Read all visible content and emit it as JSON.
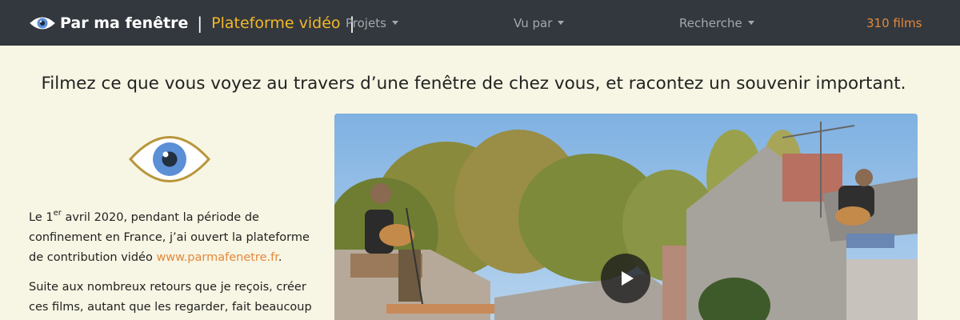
{
  "navbar": {
    "brand_title": "Par ma fenêtre",
    "brand_separator": "|",
    "brand_subtitle": "Plateforme vidéo",
    "items": [
      {
        "label": "Projets"
      },
      {
        "label": "Vu par"
      },
      {
        "label": "Recherche"
      }
    ],
    "films_count": "310 films",
    "brand_icon": "eye-icon"
  },
  "headline": "Filmez ce que vous voyez au travers d’une fenêtre de chez vous, et racontez un souvenir important.",
  "intro": {
    "p1_start": "Le 1",
    "p1_sup": "er",
    "p1_mid": " avril 2020, pendant la période de confinement en France, j’ai ouvert la plateforme de contribution vidéo ",
    "p1_link": "www.parmafenetre.fr",
    "p1_end": ".",
    "p2": "Suite aux nombreux retours que je reçois, créer ces films, autant que les regarder, fait beaucoup"
  },
  "video": {
    "play_icon": "play-icon"
  },
  "colors": {
    "navbar_bg": "#33383e",
    "page_bg": "#f7f5e3",
    "accent_yellow": "#f3b82a",
    "accent_orange": "#e5883b",
    "eye_blue": "#5b8fd6"
  }
}
